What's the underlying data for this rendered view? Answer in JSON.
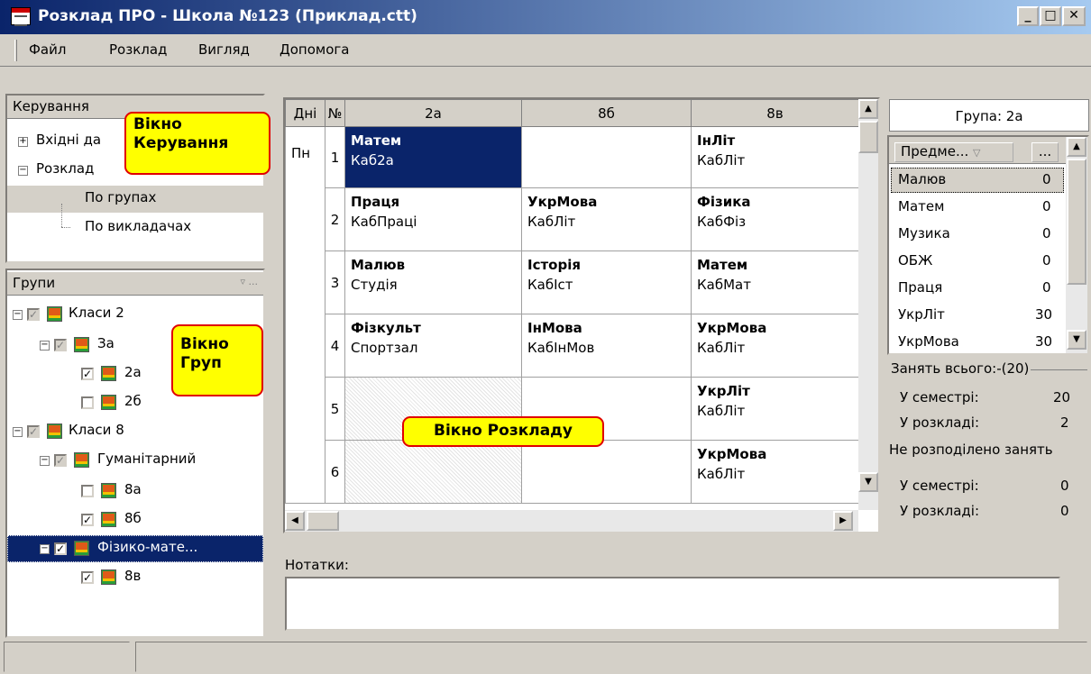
{
  "window": {
    "title": "Розклад ПРО - Школа №123 (Приклад.ctt)"
  },
  "menu": [
    "Файл",
    "Розклад",
    "Вигляд",
    "Допомога"
  ],
  "control_panel": {
    "header": "Керування",
    "items": [
      "Вхідні да",
      "Розклад",
      "По групах",
      "По викладачах"
    ],
    "callout": [
      "Вікно",
      "Керування"
    ]
  },
  "groups_panel": {
    "header": "Групи",
    "filter_button": "...",
    "items": [
      "Класи 2",
      "За",
      "2а",
      "2б",
      "Класи 8",
      "Гуманітарний",
      "8а",
      "8б",
      "Фізико-мате...",
      "8в"
    ],
    "callout": [
      "Вікно",
      "Груп"
    ]
  },
  "schedule": {
    "col_headers": [
      "Дні",
      "№",
      "2а",
      "8б",
      "8в"
    ],
    "day": "Пн",
    "rows": [
      {
        "n": "1",
        "cells": [
          {
            "subj": "Матем",
            "room": "Каб2а"
          },
          {
            "subj": "",
            "room": ""
          },
          {
            "subj": "ІнЛіт",
            "room": "КабЛіт"
          }
        ]
      },
      {
        "n": "2",
        "cells": [
          {
            "subj": "Праця",
            "room": "КабПраці"
          },
          {
            "subj": "УкрМова",
            "room": "КабЛіт"
          },
          {
            "subj": "Фізика",
            "room": "КабФіз"
          }
        ]
      },
      {
        "n": "3",
        "cells": [
          {
            "subj": "Малюв",
            "room": "Студія"
          },
          {
            "subj": "Історія",
            "room": "КабІст"
          },
          {
            "subj": "Матем",
            "room": "КабМат"
          }
        ]
      },
      {
        "n": "4",
        "cells": [
          {
            "subj": "Фізкульт",
            "room": "Спортзал"
          },
          {
            "subj": "ІнМова",
            "room": "КабІнМов"
          },
          {
            "subj": "УкрМова",
            "room": "КабЛіт"
          }
        ]
      },
      {
        "n": "5",
        "cells": [
          {
            "subj": "",
            "room": ""
          },
          {
            "subj": "",
            "room": ""
          },
          {
            "subj": "УкрЛіт",
            "room": "КабЛіт"
          }
        ]
      },
      {
        "n": "6",
        "cells": [
          {
            "subj": "",
            "room": ""
          },
          {
            "subj": "",
            "room": ""
          },
          {
            "subj": "УкрМова",
            "room": "КабЛіт"
          }
        ]
      }
    ],
    "callout": "Вікно Розкладу"
  },
  "group_info": {
    "title": "Група: 2а",
    "col_subject": "Предме...",
    "col_extra": "...",
    "subjects": [
      {
        "name": "Малюв",
        "count": "0"
      },
      {
        "name": "Матем",
        "count": "0"
      },
      {
        "name": "Музика",
        "count": "0"
      },
      {
        "name": "ОБЖ",
        "count": "0"
      },
      {
        "name": "Праця",
        "count": "0"
      },
      {
        "name": "УкрЛіт",
        "count": "30"
      },
      {
        "name": "УкрМова",
        "count": "30"
      }
    ],
    "total_label": "Занять всього:-(20)",
    "sem_label": "У семестрі:",
    "sem_val": "20",
    "sched_label": "У розкладі:",
    "sched_val": "2",
    "undist_label": "Не розподілено занять",
    "sem2_label": "У семестрі:",
    "sem2_val": "0",
    "sched2_label": "У розкладі:",
    "sched2_val": "0"
  },
  "notes": {
    "label": "Нотатки:",
    "value": ""
  }
}
